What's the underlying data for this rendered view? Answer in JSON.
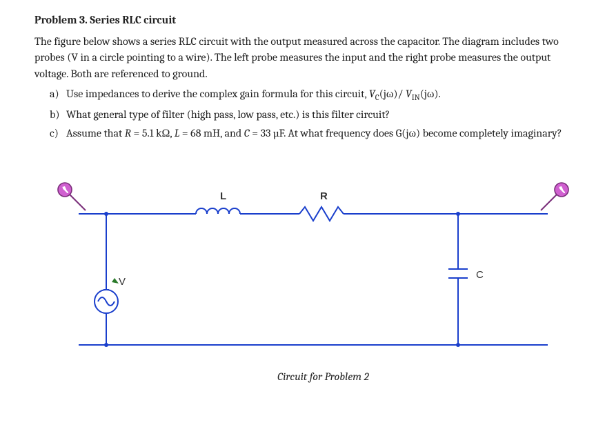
{
  "problem": {
    "heading_prefix": "Problem 3.",
    "heading_title": "Series RLC circuit",
    "intro": "The figure below shows a series RLC circuit with the output measured across the capacitor. The diagram includes two probes (V in a circle pointing to a wire). The left probe measures the input and the right probe measures the output voltage. Both are referenced to ground.",
    "items": [
      {
        "marker": "a)",
        "text_pre": "Use impedances to derive the complex gain formula for this circuit, ",
        "gain_num": "V",
        "gain_num_sub": "C",
        "gain_num_arg": "(jω)/ ",
        "gain_den": "V",
        "gain_den_sub": "IN",
        "gain_den_arg": "(jω).",
        "text_post": ""
      },
      {
        "marker": "b)",
        "text_pre": "What general type of filter (high pass, low pass, etc.) is this filter circuit?",
        "gain_num": "",
        "gain_num_sub": "",
        "gain_num_arg": "",
        "gain_den": "",
        "gain_den_sub": "",
        "gain_den_arg": "",
        "text_post": ""
      },
      {
        "marker": "c)",
        "text_pre": "Assume that ",
        "R_sym": "R",
        "R_eq": " = 5.1 kΩ, ",
        "L_sym": "L",
        "L_eq": " = 68 mH, and ",
        "C_sym": "C",
        "C_eq": " = 33 µF.  At what frequency does G(jω) become completely imaginary?",
        "gain_num": "",
        "gain_num_sub": "",
        "gain_num_arg": "",
        "gain_den": "",
        "gain_den_sub": "",
        "gain_den_arg": "",
        "text_post": ""
      }
    ]
  },
  "circuit": {
    "labels": {
      "L": "L",
      "R": "R",
      "C": "C",
      "V": "V"
    },
    "caption": "Circuit for Problem 2",
    "colors": {
      "wire": "#1a3fcc",
      "ground_wire": "#1a3fcc",
      "label": "#333333",
      "probe_fill": "#d060d0",
      "probe_stroke": "#7a2e7a"
    }
  }
}
